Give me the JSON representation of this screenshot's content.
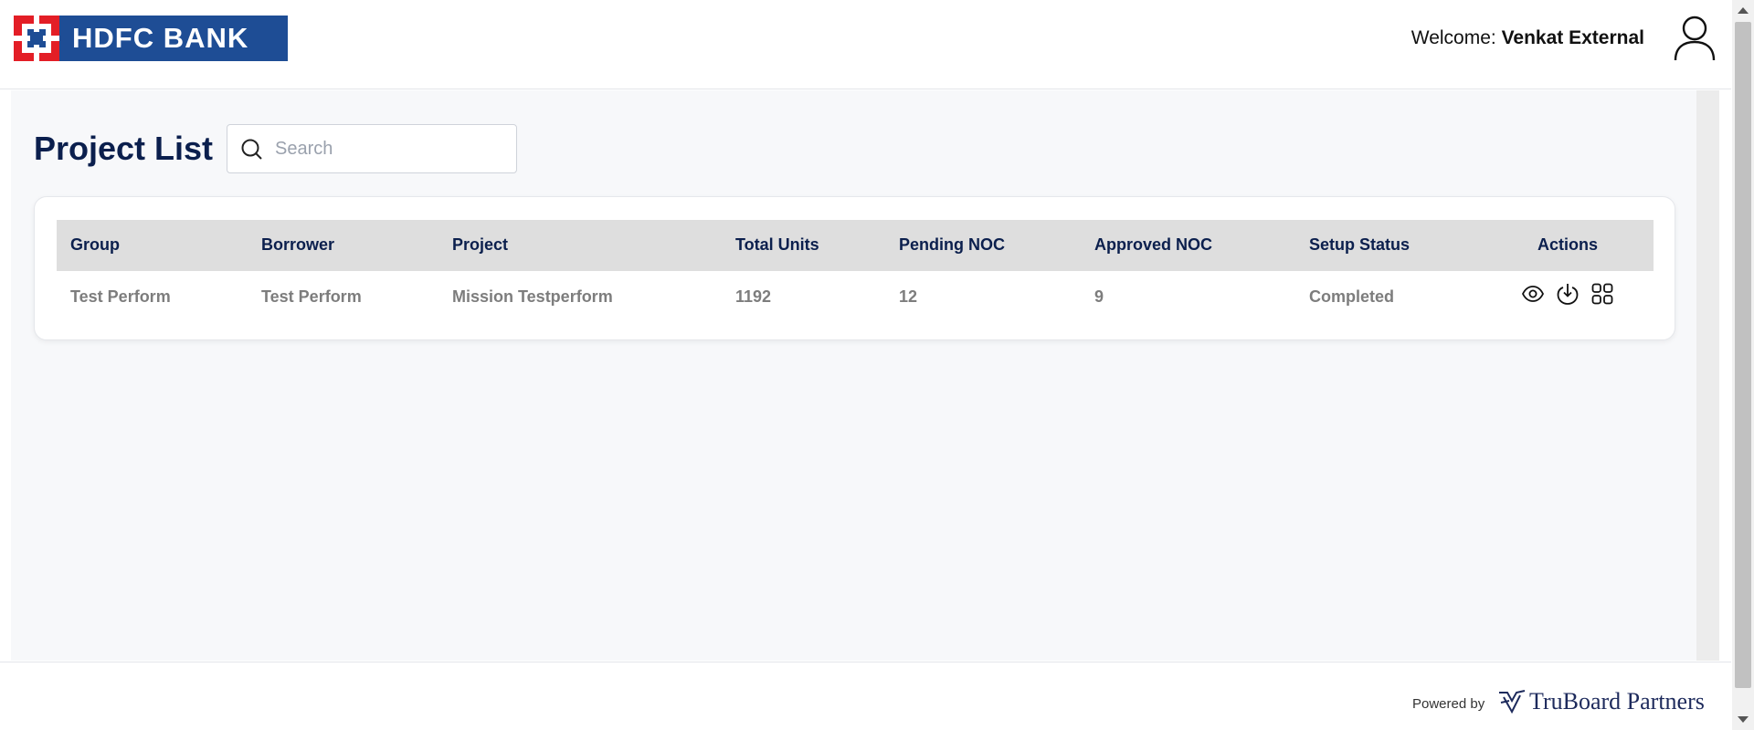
{
  "brand": {
    "name": "HDFC BANK",
    "colors": {
      "blue": "#1e4d95",
      "red": "#e31e26"
    }
  },
  "header": {
    "welcome_prefix": "Welcome:",
    "user_name": "Venkat External",
    "avatar_icon": "user-icon"
  },
  "page": {
    "title": "Project List"
  },
  "search": {
    "placeholder": "Search",
    "value": "",
    "icon": "search-icon"
  },
  "table": {
    "columns": [
      "Group",
      "Borrower",
      "Project",
      "Total Units",
      "Pending NOC",
      "Approved NOC",
      "Setup Status",
      "Actions"
    ],
    "rows": [
      {
        "group": "Test Perform",
        "borrower": "Test Perform",
        "project": "Mission Testperform",
        "total_units": "1192",
        "pending_noc": "12",
        "approved_noc": "9",
        "setup_status": "Completed",
        "actions": [
          "eye-icon",
          "download-icon",
          "grid-icon"
        ]
      }
    ]
  },
  "footer": {
    "powered_by": "Powered by",
    "partner_name": "TruBoard Partners"
  }
}
